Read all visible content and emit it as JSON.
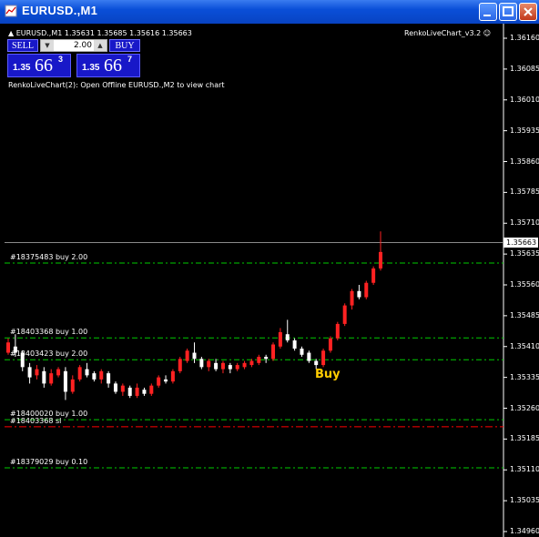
{
  "window": {
    "title": "EURUSD.,M1"
  },
  "header": {
    "symbol_line": "EURUSD.,M1  1.35631 1.35685 1.35616 1.35663",
    "indicator_name": "RenkoLiveChart_v3.2",
    "status_text": "RenkoLiveChart(2): Open Offline EURUSD.,M2 to view chart"
  },
  "trade_panel": {
    "sell_label": "SELL",
    "buy_label": "BUY",
    "lot_value": "2.00",
    "sell_price": {
      "small": "1.35",
      "big": "66",
      "sup": "3"
    },
    "buy_price": {
      "small": "1.35",
      "big": "66",
      "sup": "7"
    }
  },
  "order_lines": [
    {
      "label": "#18375483 buy 2.00",
      "price": 1.35613,
      "color": "#00cc00"
    },
    {
      "label": "#18403368 buy 1.00",
      "price": 1.35431,
      "color": "#00cc00"
    },
    {
      "label": "#18403423 buy 2.00",
      "price": 1.35378,
      "color": "#00cc00"
    },
    {
      "label": "#18400020 buy 1.00",
      "price": 1.35232,
      "color": "#00cc00"
    },
    {
      "label": "#18403368 sl",
      "price": 1.35215,
      "color": "#ff0000"
    },
    {
      "label": "#18379029 buy 0.10",
      "price": 1.35115,
      "color": "#00cc00"
    }
  ],
  "current_price": "1.35663",
  "annotation": "Buy",
  "chart_data": {
    "type": "candlestick",
    "price_axis": {
      "ticks": [
        "1.36160",
        "1.36085",
        "1.36010",
        "1.35935",
        "1.35860",
        "1.35785",
        "1.35710",
        "1.35635",
        "1.35560",
        "1.35485",
        "1.35410",
        "1.35335",
        "1.35260",
        "1.35185",
        "1.35110",
        "1.35035",
        "1.34960"
      ],
      "range": [
        1.3496,
        1.3616
      ]
    },
    "candles": [
      {
        "o": 1.35395,
        "c": 1.3542,
        "h": 1.3543,
        "l": 1.3539
      },
      {
        "o": 1.3541,
        "c": 1.35395,
        "h": 1.3544,
        "l": 1.35385
      },
      {
        "o": 1.35395,
        "c": 1.3536,
        "h": 1.354,
        "l": 1.3535
      },
      {
        "o": 1.3536,
        "c": 1.35335,
        "h": 1.3537,
        "l": 1.3532
      },
      {
        "o": 1.3534,
        "c": 1.35355,
        "h": 1.35365,
        "l": 1.3533
      },
      {
        "o": 1.3535,
        "c": 1.3532,
        "h": 1.3536,
        "l": 1.3531
      },
      {
        "o": 1.3532,
        "c": 1.35345,
        "h": 1.35355,
        "l": 1.35315
      },
      {
        "o": 1.3534,
        "c": 1.35355,
        "h": 1.3536,
        "l": 1.35335
      },
      {
        "o": 1.3535,
        "c": 1.353,
        "h": 1.3536,
        "l": 1.3528
      },
      {
        "o": 1.353,
        "c": 1.3533,
        "h": 1.3534,
        "l": 1.35295
      },
      {
        "o": 1.3533,
        "c": 1.3536,
        "h": 1.35365,
        "l": 1.35325
      },
      {
        "o": 1.35355,
        "c": 1.3534,
        "h": 1.3537,
        "l": 1.35335
      },
      {
        "o": 1.35345,
        "c": 1.3533,
        "h": 1.3535,
        "l": 1.35325
      },
      {
        "o": 1.3533,
        "c": 1.3535,
        "h": 1.35355,
        "l": 1.3532
      },
      {
        "o": 1.35345,
        "c": 1.3532,
        "h": 1.3535,
        "l": 1.3531
      },
      {
        "o": 1.3532,
        "c": 1.353,
        "h": 1.35325,
        "l": 1.35295
      },
      {
        "o": 1.353,
        "c": 1.35315,
        "h": 1.3532,
        "l": 1.3529
      },
      {
        "o": 1.3531,
        "c": 1.3529,
        "h": 1.35315,
        "l": 1.35285
      },
      {
        "o": 1.3529,
        "c": 1.3531,
        "h": 1.3532,
        "l": 1.35285
      },
      {
        "o": 1.35305,
        "c": 1.35295,
        "h": 1.3531,
        "l": 1.3529
      },
      {
        "o": 1.35295,
        "c": 1.35315,
        "h": 1.3532,
        "l": 1.3529
      },
      {
        "o": 1.35315,
        "c": 1.35335,
        "h": 1.3534,
        "l": 1.3531
      },
      {
        "o": 1.3533,
        "c": 1.35325,
        "h": 1.3534,
        "l": 1.3532
      },
      {
        "o": 1.35325,
        "c": 1.3535,
        "h": 1.35355,
        "l": 1.3532
      },
      {
        "o": 1.3535,
        "c": 1.3538,
        "h": 1.35385,
        "l": 1.35345
      },
      {
        "o": 1.35375,
        "c": 1.354,
        "h": 1.35405,
        "l": 1.3537
      },
      {
        "o": 1.35395,
        "c": 1.3538,
        "h": 1.3542,
        "l": 1.3537
      },
      {
        "o": 1.3538,
        "c": 1.3536,
        "h": 1.35385,
        "l": 1.35355
      },
      {
        "o": 1.3536,
        "c": 1.35375,
        "h": 1.3538,
        "l": 1.3535
      },
      {
        "o": 1.3537,
        "c": 1.35355,
        "h": 1.3538,
        "l": 1.3535
      },
      {
        "o": 1.35355,
        "c": 1.3537,
        "h": 1.35375,
        "l": 1.35345
      },
      {
        "o": 1.35365,
        "c": 1.35355,
        "h": 1.3537,
        "l": 1.35345
      },
      {
        "o": 1.35355,
        "c": 1.35365,
        "h": 1.3537,
        "l": 1.3535
      },
      {
        "o": 1.3536,
        "c": 1.3537,
        "h": 1.35375,
        "l": 1.35355
      },
      {
        "o": 1.35365,
        "c": 1.35375,
        "h": 1.3538,
        "l": 1.3536
      },
      {
        "o": 1.3537,
        "c": 1.35385,
        "h": 1.3539,
        "l": 1.35365
      },
      {
        "o": 1.35385,
        "c": 1.3538,
        "h": 1.3539,
        "l": 1.3537
      },
      {
        "o": 1.3538,
        "c": 1.35415,
        "h": 1.3542,
        "l": 1.35375
      },
      {
        "o": 1.3541,
        "c": 1.35445,
        "h": 1.35455,
        "l": 1.35405
      },
      {
        "o": 1.3544,
        "c": 1.35425,
        "h": 1.35475,
        "l": 1.3542
      },
      {
        "o": 1.35425,
        "c": 1.35405,
        "h": 1.3543,
        "l": 1.354
      },
      {
        "o": 1.35405,
        "c": 1.3539,
        "h": 1.3541,
        "l": 1.35385
      },
      {
        "o": 1.35395,
        "c": 1.35375,
        "h": 1.354,
        "l": 1.3537
      },
      {
        "o": 1.35375,
        "c": 1.35365,
        "h": 1.3538,
        "l": 1.35355
      },
      {
        "o": 1.35365,
        "c": 1.354,
        "h": 1.35405,
        "l": 1.3536
      },
      {
        "o": 1.354,
        "c": 1.3543,
        "h": 1.35435,
        "l": 1.35395
      },
      {
        "o": 1.3543,
        "c": 1.35465,
        "h": 1.3547,
        "l": 1.35425
      },
      {
        "o": 1.35465,
        "c": 1.3551,
        "h": 1.35515,
        "l": 1.3546
      },
      {
        "o": 1.3551,
        "c": 1.35545,
        "h": 1.3555,
        "l": 1.355
      },
      {
        "o": 1.35545,
        "c": 1.3553,
        "h": 1.3556,
        "l": 1.35525
      },
      {
        "o": 1.3553,
        "c": 1.35565,
        "h": 1.3557,
        "l": 1.35525
      },
      {
        "o": 1.35565,
        "c": 1.356,
        "h": 1.35605,
        "l": 1.3556
      },
      {
        "o": 1.356,
        "c": 1.3564,
        "h": 1.3569,
        "l": 1.35595
      }
    ]
  }
}
